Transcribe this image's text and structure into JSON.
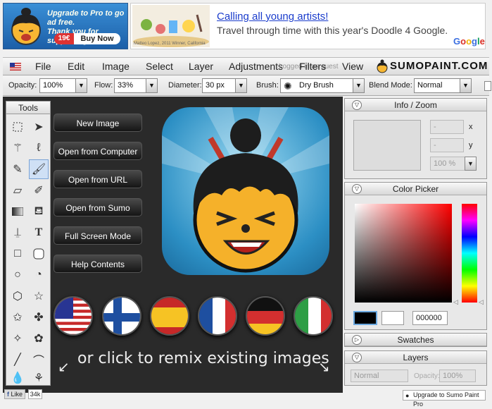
{
  "ads": {
    "sumo_ad": {
      "line1": "Upgrade to Pro to go ad free.",
      "line2": "Thank you for supporting Sumo!",
      "price": "19€",
      "buy": "Buy Now"
    },
    "google_ad": {
      "headline": "Calling all young artists!",
      "body": "Travel through time with this year's Doodle 4 Google.",
      "credit": "Matteo Lopez, 2011 Winner, California",
      "logo": "Google"
    }
  },
  "menu": {
    "items": [
      "File",
      "Edit",
      "Image",
      "Select",
      "Layer",
      "Adjustments",
      "Filters",
      "View"
    ],
    "logged_in": "Logged in as guest",
    "brand": "SUMOPAINT.COM"
  },
  "toolbar": {
    "opacity_label": "Opacity:",
    "opacity_value": "100%",
    "flow_label": "Flow:",
    "flow_value": "33%",
    "diameter_label": "Diameter:",
    "diameter_value": "30 px",
    "brush_label": "Brush:",
    "brush_value": "Dry Brush",
    "blend_label": "Blend Mode:",
    "blend_value": "Normal"
  },
  "tools": {
    "title": "Tools",
    "selected": "brush"
  },
  "start_buttons": [
    "New Image",
    "Open from Computer",
    "Open from URL",
    "Open from Sumo",
    "Full Screen Mode",
    "Help Contents"
  ],
  "flags": [
    "usa",
    "finland",
    "spain",
    "france",
    "germany",
    "italy"
  ],
  "remix_text": "or click to remix existing images",
  "info_zoom": {
    "title": "Info / Zoom",
    "x_label": "x",
    "y_label": "y",
    "x_value": "-",
    "y_value": "-",
    "zoom": "100 %"
  },
  "color_picker": {
    "title": "Color Picker",
    "hex": "000000"
  },
  "swatches": {
    "title": "Swatches"
  },
  "layers": {
    "title": "Layers",
    "blend": "Normal",
    "opacity_label": "Opacity:",
    "opacity_value": "100%"
  },
  "footer": {
    "like": "Like",
    "like_count": "34k",
    "upgrade": "Upgrade to Sumo Paint Pro"
  }
}
